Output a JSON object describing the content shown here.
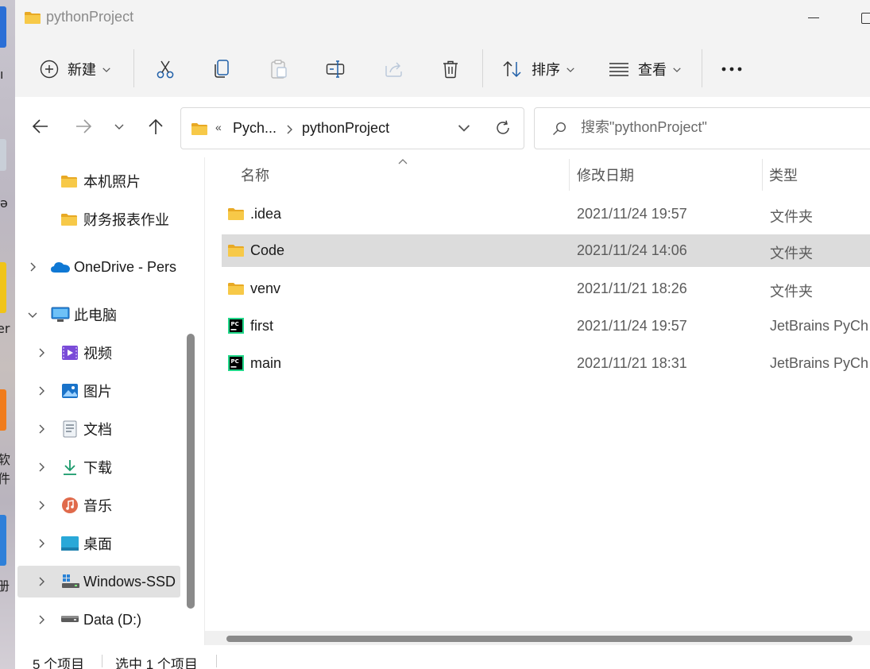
{
  "window": {
    "title": "pythonProject"
  },
  "toolbar": {
    "new_label": "新建",
    "sort_label": "排序",
    "view_label": "查看",
    "more_label": "•••"
  },
  "address": {
    "overflow": "«",
    "crumbs": [
      "Pych...",
      "pythonProject"
    ]
  },
  "search": {
    "placeholder": "搜索\"pythonProject\""
  },
  "sidebar": {
    "items": [
      {
        "label": "本机照片",
        "icon": "folder-icon"
      },
      {
        "label": "财务报表作业",
        "icon": "folder-icon"
      },
      {
        "label": "OneDrive - Pers",
        "icon": "onedrive-icon"
      },
      {
        "label": "此电脑",
        "icon": "computer-icon"
      },
      {
        "label": "视频",
        "icon": "videos-icon"
      },
      {
        "label": "图片",
        "icon": "pictures-icon"
      },
      {
        "label": "文档",
        "icon": "documents-icon"
      },
      {
        "label": "下载",
        "icon": "downloads-icon"
      },
      {
        "label": "音乐",
        "icon": "music-icon"
      },
      {
        "label": "桌面",
        "icon": "desktop-icon"
      },
      {
        "label": "Windows-SSD",
        "icon": "drive-c-icon",
        "selected": true
      },
      {
        "label": "Data (D:)",
        "icon": "drive-d-icon"
      }
    ]
  },
  "columns": {
    "name": "名称",
    "modified": "修改日期",
    "type": "类型"
  },
  "files": [
    {
      "name": ".idea",
      "modified": "2021/11/24 19:57",
      "type": "文件夹",
      "icon": "folder-icon"
    },
    {
      "name": "Code",
      "modified": "2021/11/24 14:06",
      "type": "文件夹",
      "icon": "folder-icon",
      "selected": true
    },
    {
      "name": "venv",
      "modified": "2021/11/21 18:26",
      "type": "文件夹",
      "icon": "folder-icon"
    },
    {
      "name": "first",
      "modified": "2021/11/24 19:57",
      "type": "JetBrains PyCh",
      "icon": "pycharm-icon"
    },
    {
      "name": "main",
      "modified": "2021/11/21 18:31",
      "type": "JetBrains PyCh",
      "icon": "pycharm-icon"
    }
  ],
  "status": {
    "item_count": "5 个项目",
    "selected": "选中 1 个项目"
  },
  "desktop": {
    "fragments": [
      "ı",
      "ǝ",
      "er",
      "软件",
      "册"
    ]
  },
  "colors": {
    "folder": "#f7c948",
    "selection": "#dcdcdc",
    "accent": "#0067c0"
  }
}
